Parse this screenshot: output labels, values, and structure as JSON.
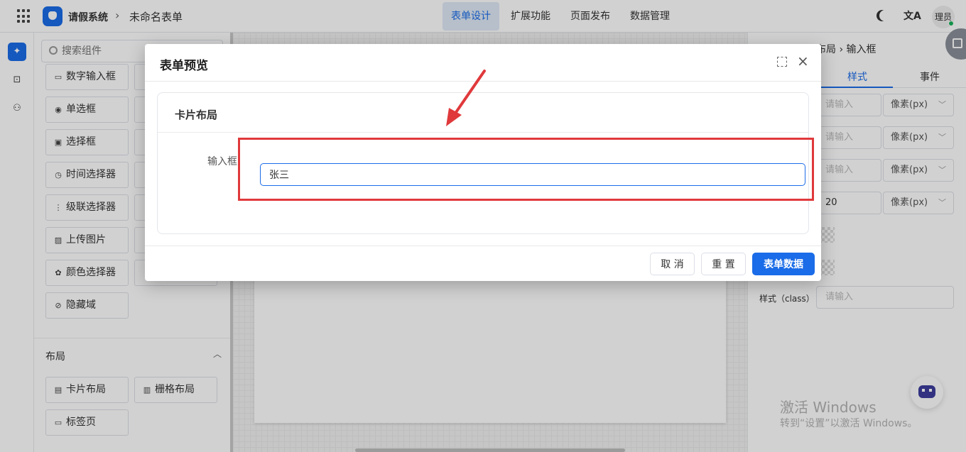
{
  "topbar": {
    "app_name": "请假系统",
    "crumb_sep": "›",
    "form_name": "未命名表单",
    "tabs": [
      {
        "label": "表单设计",
        "active": true
      },
      {
        "label": "扩展功能",
        "active": false
      },
      {
        "label": "页面发布",
        "active": false
      },
      {
        "label": "数据管理",
        "active": false
      }
    ],
    "translate_glyph": "文A",
    "avatar_text": "理员"
  },
  "iconbar": {
    "icons": [
      "puzzle-icon",
      "code-icon",
      "tree-icon"
    ]
  },
  "component_panel": {
    "search_placeholder": "搜索组件",
    "items": [
      {
        "label": "数字输入框",
        "icon": "number-input-icon",
        "glyph": "▭"
      },
      {
        "label": "单选框",
        "icon": "radio-icon",
        "glyph": "◉"
      },
      {
        "label": "选择框",
        "icon": "select-icon",
        "glyph": "▣"
      },
      {
        "label": "时间选择器",
        "icon": "clock-icon",
        "glyph": "◷"
      },
      {
        "label": "级联选择器",
        "icon": "cascader-icon",
        "glyph": "⋮"
      },
      {
        "label": "上传图片",
        "icon": "image-icon",
        "glyph": "▨"
      },
      {
        "label": "颜色选择器",
        "icon": "palette-icon",
        "glyph": "✿"
      },
      {
        "label": "隐藏域",
        "icon": "eye-off-icon",
        "glyph": "⊘"
      }
    ],
    "layout_section": {
      "title": "布局",
      "chevron": "︿",
      "items": [
        {
          "label": "卡片布局",
          "icon": "card-layout-icon",
          "glyph": "▤"
        },
        {
          "label": "栅格布局",
          "icon": "grid-layout-icon",
          "glyph": "▥"
        },
        {
          "label": "标签页",
          "icon": "tabs-icon",
          "glyph": "▭"
        }
      ]
    }
  },
  "property_panel": {
    "breadcrumb": "布局 › 输入框",
    "tabs": [
      {
        "label": "样式",
        "active": true
      },
      {
        "label": "事件",
        "active": false
      }
    ],
    "rows": [
      {
        "value": "请输入",
        "filled": false,
        "unit": "像素(px)"
      },
      {
        "value": "请输入",
        "filled": false,
        "unit": "像素(px)"
      },
      {
        "value": "请输入",
        "filled": false,
        "unit": "像素(px)"
      },
      {
        "value": "20",
        "filled": true,
        "unit": "像素(px)"
      }
    ],
    "class_label": "样式（class）",
    "class_placeholder": "请输入"
  },
  "watermark": {
    "line1": "激活 Windows",
    "line2": "转到“设置”以激活 Windows。"
  },
  "dialog": {
    "title": "表单预览",
    "close_glyph": "×",
    "card_title": "卡片布局",
    "field_label": "输入框",
    "field_value": "张三",
    "buttons": {
      "cancel": "取 消",
      "reset": "重 置",
      "form_data": "表单数据"
    }
  },
  "colors": {
    "primary": "#1a6ce8",
    "annotation_red": "#e0393b",
    "status_online": "#19b35a"
  }
}
